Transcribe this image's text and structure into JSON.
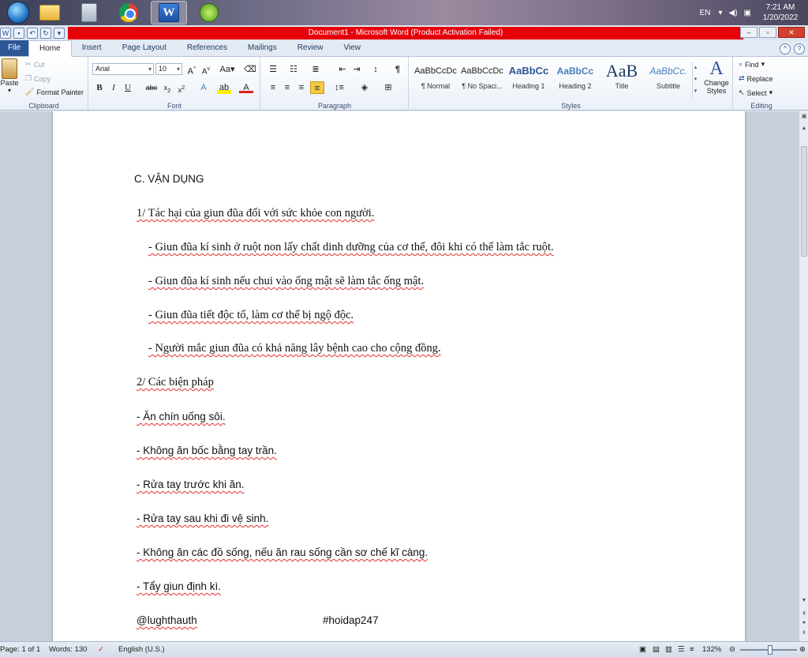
{
  "taskbar": {
    "language": "EN",
    "time": "7:21 AM",
    "date": "1/20/2022"
  },
  "window": {
    "title": "Document1 - Microsoft Word (Product Activation Failed)"
  },
  "tabs": [
    "File",
    "Home",
    "Insert",
    "Page Layout",
    "References",
    "Mailings",
    "Review",
    "View"
  ],
  "active_tab": "Home",
  "ribbon": {
    "clipboard": {
      "label": "Clipboard",
      "paste": "Paste",
      "cut": "Cut",
      "copy": "Copy",
      "format_painter": "Format Painter"
    },
    "font": {
      "label": "Font",
      "font_name": "Arial",
      "font_size": "10"
    },
    "paragraph": {
      "label": "Paragraph"
    },
    "styles": {
      "label": "Styles",
      "items": [
        {
          "sample": "AaBbCcDc",
          "name": "¶ Normal"
        },
        {
          "sample": "AaBbCcDc",
          "name": "¶ No Spaci..."
        },
        {
          "sample": "AaBbCc",
          "name": "Heading 1"
        },
        {
          "sample": "AaBbCc",
          "name": "Heading 2"
        },
        {
          "sample": "AaB",
          "name": "Title"
        },
        {
          "sample": "AaBbCc.",
          "name": "Subtitle"
        }
      ],
      "change_styles": "Change Styles"
    },
    "editing": {
      "label": "Editing",
      "find": "Find",
      "replace": "Replace",
      "select": "Select"
    }
  },
  "document": {
    "heading": "C. VẬN DỤNG",
    "section1_title": "1/ Tác hại của giun đũa đối với sức khỏe con người.",
    "section1_items": [
      "- Giun đũa kí sinh ở ruột non lấy chất dinh dưỡng của cơ thể, đôi khi có thể làm tắc ruột.",
      "- Giun đũa kí sinh nếu chui vào ống mật sẽ làm tắc ống mật.",
      "- Giun đũa tiết độc tố, làm cơ thể bị ngộ độc.",
      "- Người mắc giun đũa có khả năng lây bệnh cao cho cộng đồng."
    ],
    "section2_title": "2/ Các biện pháp",
    "section2_items": [
      "- Ăn chín uống sôi.",
      "- Không ăn bốc bằng tay trần.",
      "- Rửa tay trước khi ăn.",
      "- Rửa tay sau khi đi vệ sinh.",
      "- Không ăn các đồ sống, nếu ăn rau sống cần sơ chế kĩ càng.",
      "- Tẩy giun định kì."
    ],
    "footer_left": "@lughthauth",
    "footer_right": "#hoidap247"
  },
  "status": {
    "page": "Page: 1 of 1",
    "words": "Words: 130",
    "language": "English (U.S.)",
    "zoom": "132%"
  }
}
